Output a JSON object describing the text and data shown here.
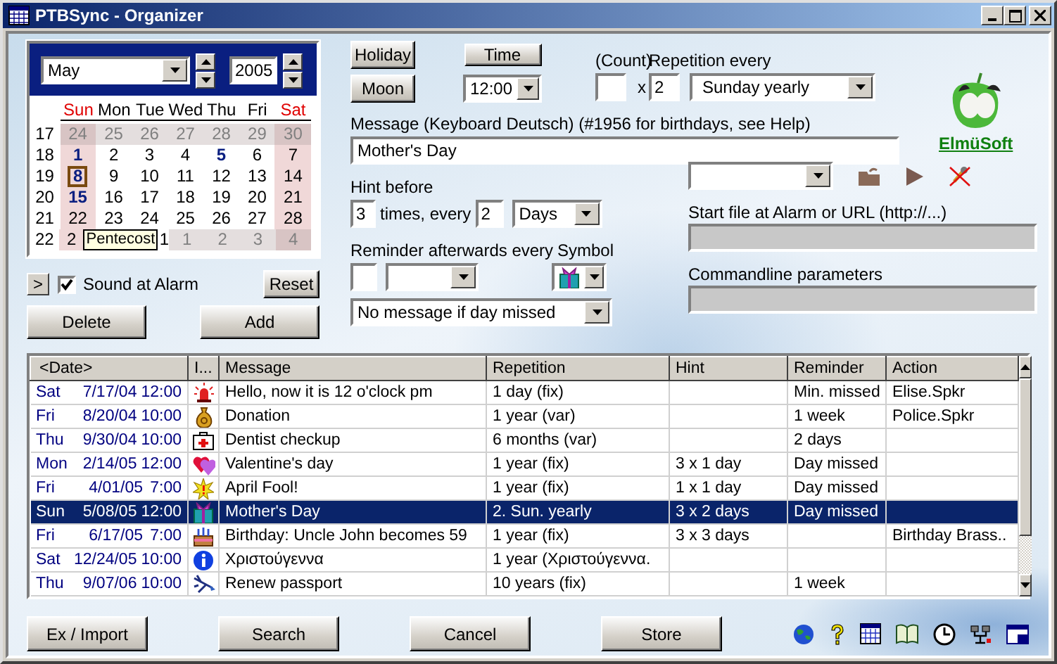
{
  "window": {
    "title": "PTBSync - Organizer"
  },
  "calendar": {
    "month": "May",
    "year": "2005",
    "weekdays": [
      {
        "label": "Sun",
        "weekend": true
      },
      {
        "label": "Mon",
        "weekend": false
      },
      {
        "label": "Tue",
        "weekend": false
      },
      {
        "label": "Wed",
        "weekend": false
      },
      {
        "label": "Thu",
        "weekend": false
      },
      {
        "label": "Fri",
        "weekend": false
      },
      {
        "label": "Sat",
        "weekend": true
      }
    ],
    "weeks": [
      {
        "week": "17",
        "days": [
          {
            "text": "24",
            "other_month": true,
            "marked": false,
            "selected": false
          },
          {
            "text": "25",
            "other_month": true,
            "marked": false,
            "selected": false
          },
          {
            "text": "26",
            "other_month": true,
            "marked": false,
            "selected": false
          },
          {
            "text": "27",
            "other_month": true,
            "marked": false,
            "selected": false
          },
          {
            "text": "28",
            "other_month": true,
            "marked": false,
            "selected": false
          },
          {
            "text": "29",
            "other_month": true,
            "marked": false,
            "selected": false
          },
          {
            "text": "30",
            "other_month": true,
            "marked": false,
            "selected": false
          }
        ]
      },
      {
        "week": "18",
        "days": [
          {
            "text": "1",
            "other_month": false,
            "marked": true,
            "selected": false
          },
          {
            "text": "2",
            "other_month": false,
            "marked": false,
            "selected": false
          },
          {
            "text": "3",
            "other_month": false,
            "marked": false,
            "selected": false
          },
          {
            "text": "4",
            "other_month": false,
            "marked": false,
            "selected": false
          },
          {
            "text": "5",
            "other_month": false,
            "marked": true,
            "selected": false
          },
          {
            "text": "6",
            "other_month": false,
            "marked": false,
            "selected": false
          },
          {
            "text": "7",
            "other_month": false,
            "marked": false,
            "selected": false
          }
        ]
      },
      {
        "week": "19",
        "days": [
          {
            "text": "8",
            "other_month": false,
            "marked": true,
            "selected": true
          },
          {
            "text": "9",
            "other_month": false,
            "marked": false,
            "selected": false
          },
          {
            "text": "10",
            "other_month": false,
            "marked": false,
            "selected": false
          },
          {
            "text": "11",
            "other_month": false,
            "marked": false,
            "selected": false
          },
          {
            "text": "12",
            "other_month": false,
            "marked": false,
            "selected": false
          },
          {
            "text": "13",
            "other_month": false,
            "marked": false,
            "selected": false
          },
          {
            "text": "14",
            "other_month": false,
            "marked": false,
            "selected": false
          }
        ]
      },
      {
        "week": "20",
        "days": [
          {
            "text": "15",
            "other_month": false,
            "marked": true,
            "selected": false
          },
          {
            "text": "16",
            "other_month": false,
            "marked": false,
            "selected": false
          },
          {
            "text": "17",
            "other_month": false,
            "marked": false,
            "selected": false
          },
          {
            "text": "18",
            "other_month": false,
            "marked": false,
            "selected": false
          },
          {
            "text": "19",
            "other_month": false,
            "marked": false,
            "selected": false
          },
          {
            "text": "20",
            "other_month": false,
            "marked": false,
            "selected": false
          },
          {
            "text": "21",
            "other_month": false,
            "marked": false,
            "selected": false
          }
        ]
      },
      {
        "week": "21",
        "days": [
          {
            "text": "22",
            "other_month": false,
            "marked": false,
            "selected": false
          },
          {
            "text": "23",
            "other_month": false,
            "marked": false,
            "selected": false
          },
          {
            "text": "24",
            "other_month": false,
            "marked": false,
            "selected": false
          },
          {
            "text": "25",
            "other_month": false,
            "marked": false,
            "selected": false
          },
          {
            "text": "26",
            "other_month": false,
            "marked": false,
            "selected": false
          },
          {
            "text": "27",
            "other_month": false,
            "marked": false,
            "selected": false
          },
          {
            "text": "28",
            "other_month": false,
            "marked": false,
            "selected": false
          }
        ]
      },
      {
        "week": "22",
        "tooltip": "Pentecost",
        "days": [
          {
            "text": "2",
            "other_month": false,
            "marked": false,
            "selected": false
          },
          {
            "text": "1",
            "other_month": false,
            "marked": false,
            "selected": false
          },
          {
            "text": "1",
            "other_month": true,
            "marked": false,
            "selected": false
          },
          {
            "text": "2",
            "other_month": true,
            "marked": false,
            "selected": false
          },
          {
            "text": "3",
            "other_month": true,
            "marked": false,
            "selected": false
          },
          {
            "text": "4",
            "other_month": true,
            "marked": false,
            "selected": false
          }
        ]
      }
    ]
  },
  "expand_button": ">",
  "sound_at_alarm": {
    "label": "Sound at Alarm",
    "checked": true
  },
  "calendar_buttons": [
    "Reset",
    "Delete",
    "Add"
  ],
  "holiday_button": "Holiday",
  "moon_button": "Moon",
  "time_button": "Time",
  "time": "12:00",
  "count": {
    "label": "(Count)",
    "times_sign": "x"
  },
  "repetition": {
    "label": "Repetition every",
    "every": "2",
    "unit": "Sunday  yearly"
  },
  "message": {
    "label": "Message  (Keyboard Deutsch) (#1956 for birthdays, see Help)",
    "value": "Mother's Day"
  },
  "hint": {
    "label": "Hint before",
    "count": "3",
    "middle": "times, every",
    "every": "2",
    "unit": "Days"
  },
  "reminder": {
    "label": "Reminder afterwards every",
    "symbol_label": "Symbol",
    "symbol": {
      "kind": "gift"
    },
    "missed_mode": "No message if day missed"
  },
  "start_file": {
    "label": "Start file at Alarm or URL (http://...)"
  },
  "commandline": {
    "label": "Commandline parameters"
  },
  "logo": {
    "text": "ElmüSoft"
  },
  "table": {
    "columns": [
      "<Date>",
      "I...",
      "Message",
      "Repetition",
      "Hint",
      "Reminder",
      "Action"
    ],
    "rows": [
      {
        "day": "Sat",
        "date": "7/17/04",
        "time": "12:00",
        "kind": "alarm",
        "message": "Hello, now it is 12 o'clock pm",
        "repetition": "1 day  (fix)",
        "reminder": "Min. missed",
        "action": "Elise.Spkr",
        "selected": false
      },
      {
        "day": "Fri",
        "date": "8/20/04",
        "time": "10:00",
        "kind": "money",
        "message": "Donation",
        "repetition": "1 year  (var)",
        "reminder": "1 week",
        "action": "Police.Spkr",
        "selected": false
      },
      {
        "day": "Thu",
        "date": "9/30/04",
        "time": "10:00",
        "kind": "firstaid",
        "message": "Dentist checkup",
        "repetition": "6 months  (var)",
        "reminder": "2 days",
        "selected": false
      },
      {
        "day": "Mon",
        "date": "2/14/05",
        "time": "12:00",
        "kind": "hearts",
        "message": "Valentine's day",
        "repetition": "1 year  (fix)",
        "hint": "3 x 1 day",
        "reminder": "Day missed",
        "selected": false
      },
      {
        "day": "Fri",
        "date": "4/01/05",
        "time": "7:00",
        "kind": "burst",
        "message": "April Fool!",
        "repetition": "1 year  (fix)",
        "hint": "1 x 1 day",
        "reminder": "Day missed",
        "selected": false
      },
      {
        "day": "Sun",
        "date": "5/08/05",
        "time": "12:00",
        "kind": "gift",
        "message": "Mother's Day",
        "repetition": "2. Sun. yearly",
        "hint": "3 x 2 days",
        "reminder": "Day missed",
        "selected": true
      },
      {
        "day": "Fri",
        "date": "6/17/05",
        "time": "7:00",
        "kind": "cake",
        "message": "Birthday: Uncle John becomes 59",
        "repetition": "1 year  (fix)",
        "hint": "3 x 3 days",
        "action": "Birthday Brass..",
        "selected": false
      },
      {
        "day": "Sat",
        "date": "12/24/05",
        "time": "10:00",
        "kind": "info",
        "message": "Χριστούγεννα",
        "repetition": "1 year (Χριστούγεννα.",
        "selected": false
      },
      {
        "day": "Thu",
        "date": "9/07/06",
        "time": "10:00",
        "kind": "plane",
        "message": "Renew passport",
        "repetition": "10 years  (fix)",
        "reminder": "1 week",
        "selected": false
      }
    ]
  },
  "bottom_buttons": [
    "Ex / Import",
    "Search",
    "Cancel",
    "Store"
  ]
}
